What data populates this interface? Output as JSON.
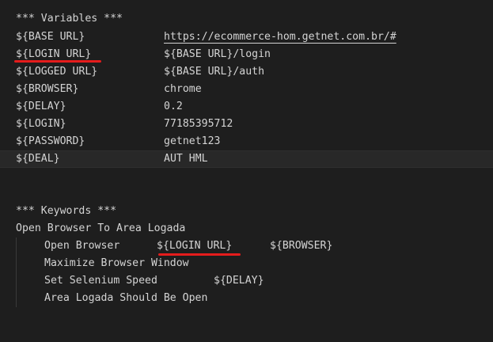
{
  "variables_section": {
    "header": "*** Variables ***",
    "rows": [
      {
        "name": "${BASE URL}",
        "value": "https://ecommerce-hom.getnet.com.br/#"
      },
      {
        "name": "${LOGIN URL}",
        "value": "${BASE URL}/login"
      },
      {
        "name": "${LOGGED URL}",
        "value": "${BASE URL}/auth"
      },
      {
        "name": "${BROWSER}",
        "value": "chrome"
      },
      {
        "name": "${DELAY}",
        "value": "0.2"
      },
      {
        "name": "${LOGIN}",
        "value": "77185395712"
      },
      {
        "name": "${PASSWORD}",
        "value": "getnet123"
      },
      {
        "name": "${DEAL}",
        "value": "AUT HML"
      }
    ]
  },
  "keywords_section": {
    "header": "*** Keywords ***",
    "keyword_name": "Open Browser To Area Logada",
    "steps": [
      {
        "keyword": "Open Browser",
        "args": [
          "${LOGIN URL}",
          "${BROWSER}"
        ]
      },
      {
        "keyword": "Maximize Browser Window",
        "args": []
      },
      {
        "keyword": "Set Selenium Speed",
        "args": [
          "${DELAY}"
        ]
      },
      {
        "keyword": "Area Logada Should Be Open",
        "args": []
      }
    ]
  },
  "colors": {
    "background": "#1e1e1e",
    "text": "#d4d4d4",
    "current_line": "#282828",
    "annotation_underline": "#e51c1c"
  }
}
